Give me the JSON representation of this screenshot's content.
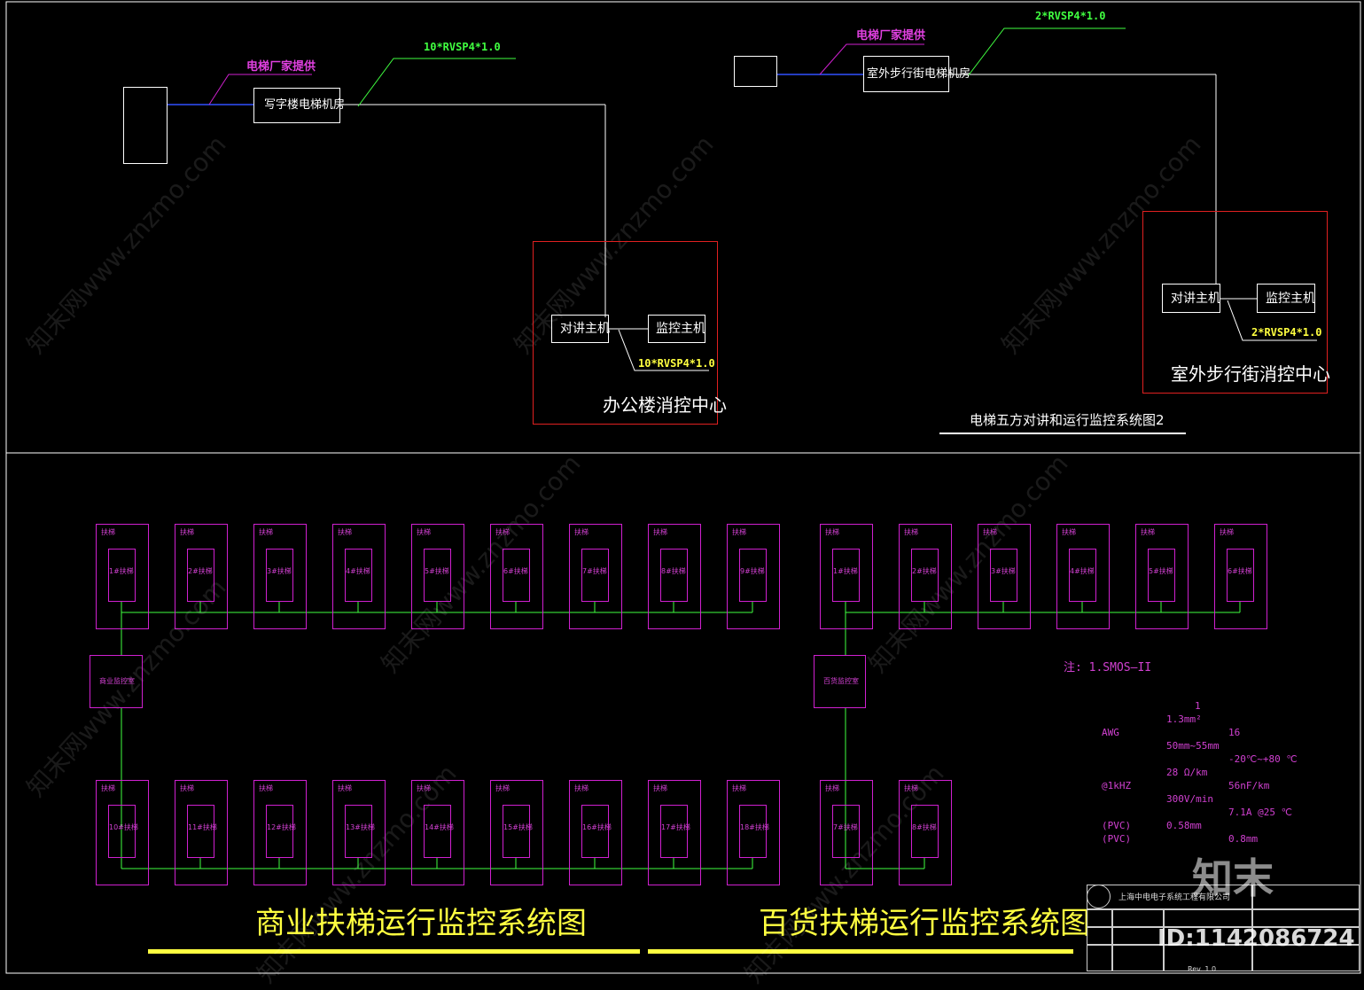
{
  "top": {
    "left": {
      "supplier_note": "电梯厂家提供",
      "machine_room": "写字楼电梯机房",
      "cable_top": "10*RVSP4*1.0",
      "host_intercom": "对讲主机",
      "host_monitor": "监控主机",
      "cable_host": "10*RVSP4*1.0",
      "center": "办公楼消控中心"
    },
    "right": {
      "supplier_note": "电梯厂家提供",
      "machine_room": "室外步行街电梯机房",
      "cable_top": "2*RVSP4*1.0",
      "host_intercom": "对讲主机",
      "host_monitor": "监控主机",
      "cable_host": "2*RVSP4*1.0",
      "center": "室外步行街消控中心"
    },
    "title": "电梯五方对讲和运行监控系统图2"
  },
  "bottom": {
    "commercial": {
      "title": "商业扶梯运行监控系统图",
      "room": "商业监控室",
      "row1": [
        "1#扶梯",
        "2#扶梯",
        "3#扶梯",
        "4#扶梯",
        "5#扶梯",
        "6#扶梯",
        "7#扶梯",
        "8#扶梯",
        "9#扶梯"
      ],
      "row2": [
        "10#扶梯",
        "11#扶梯",
        "12#扶梯",
        "13#扶梯",
        "14#扶梯",
        "15#扶梯",
        "16#扶梯",
        "17#扶梯",
        "18#扶梯"
      ],
      "cell_label": "扶梯"
    },
    "department": {
      "title": "百货扶梯运行监控系统图",
      "room": "百货监控室",
      "row1": [
        "1#扶梯",
        "2#扶梯",
        "3#扶梯",
        "4#扶梯",
        "5#扶梯",
        "6#扶梯"
      ],
      "row2": [
        "7#扶梯",
        "8#扶梯"
      ],
      "cell_label": "扶梯"
    }
  },
  "notes": {
    "heading": "注: 1.SMOS—II",
    "lines": [
      [
        "",
        "1.3mm²"
      ],
      [
        "AWG",
        "16"
      ],
      [
        "",
        "50mm~55mm"
      ],
      [
        "",
        "-20℃~+80 ℃"
      ],
      [
        "",
        "28 Ω/km"
      ],
      [
        "@1kHZ",
        "56nF/km"
      ],
      [
        "",
        "300V/min"
      ],
      [
        "",
        "7.1A @25 ℃"
      ],
      [
        "(PVC)",
        "0.58mm"
      ],
      [
        "(PVC)",
        "0.8mm"
      ]
    ],
    "count": "1"
  },
  "title_block": {
    "company": "上海中电电子系统工程有限公司",
    "scale": "Rev. 1.0"
  },
  "watermark": {
    "text": "知末网www.znzmo.com",
    "logo": "知末",
    "id": "ID:1142086724"
  },
  "colors": {
    "background": "#000000",
    "frame": "#ffffff",
    "center_box": "#e02020",
    "escalator": "#d020d0",
    "bus": "#40ff40",
    "cable_label": "#ffff40"
  }
}
